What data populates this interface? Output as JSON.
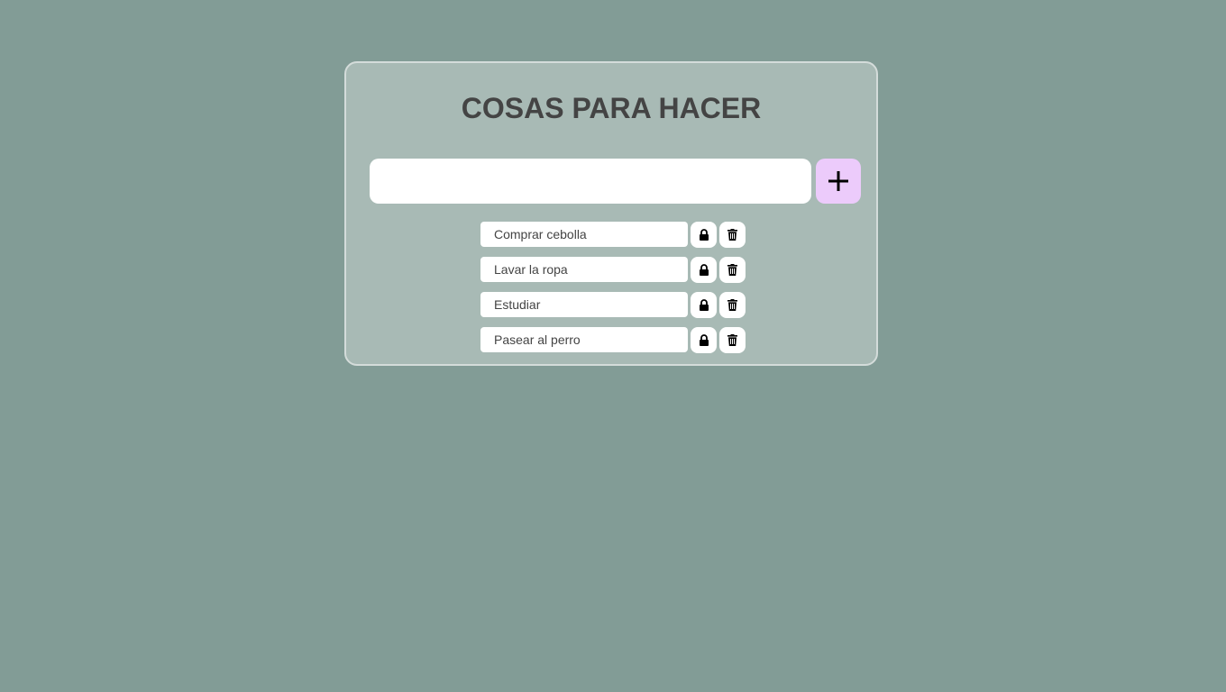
{
  "app": {
    "title": "COSAS PARA HACER"
  },
  "new_task": {
    "value": "",
    "placeholder": "",
    "add_icon": "plus-icon"
  },
  "tasks": [
    {
      "text": "Comprar cebolla",
      "lock_icon": "lock-icon",
      "delete_icon": "trash-icon"
    },
    {
      "text": "Lavar la ropa",
      "lock_icon": "lock-icon",
      "delete_icon": "trash-icon"
    },
    {
      "text": "Estudiar",
      "lock_icon": "lock-icon",
      "delete_icon": "trash-icon"
    },
    {
      "text": "Pasear al perro",
      "lock_icon": "lock-icon",
      "delete_icon": "trash-icon"
    }
  ],
  "colors": {
    "background": "#829c96",
    "card": "#a8bab5",
    "card_border": "#d4dcda",
    "title": "#444444",
    "add_button": "#eccbfb"
  }
}
